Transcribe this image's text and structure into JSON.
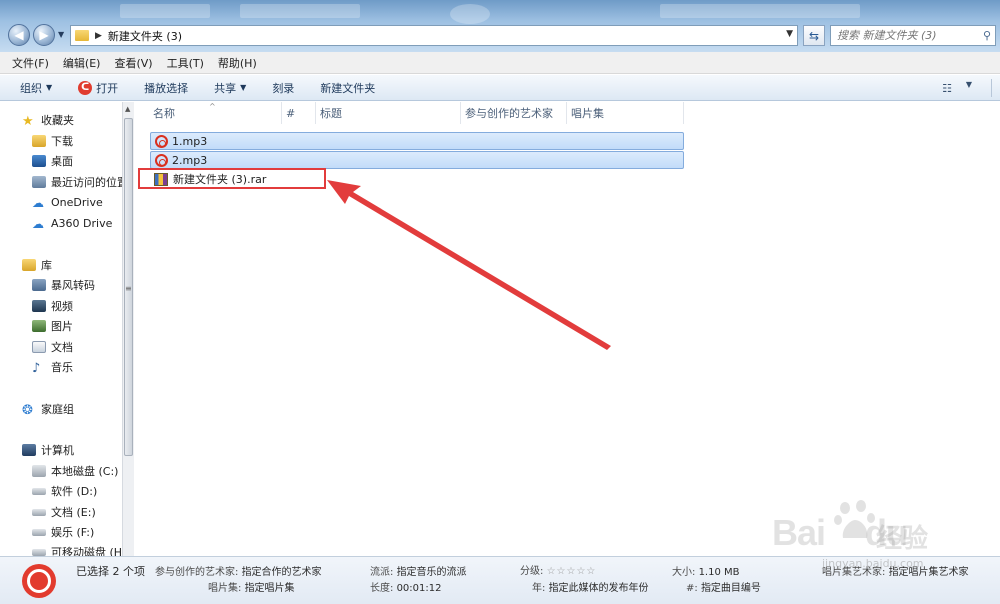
{
  "address": {
    "path": "新建文件夹 (3)"
  },
  "search": {
    "placeholder": "搜索 新建文件夹 (3)"
  },
  "menu": [
    "文件(F)",
    "编辑(E)",
    "查看(V)",
    "工具(T)",
    "帮助(H)"
  ],
  "toolbar": {
    "organize": "组织",
    "open": "打开",
    "play_all": "播放选择",
    "share": "共享",
    "burn": "刻录",
    "new_folder": "新建文件夹"
  },
  "sidebar": {
    "favorites": "收藏夹",
    "fav_items": [
      "下载",
      "桌面",
      "最近访问的位置",
      "OneDrive",
      "A360 Drive"
    ],
    "library": "库",
    "lib_items": [
      "暴风转码",
      "视频",
      "图片",
      "文档",
      "音乐"
    ],
    "homegroup": "家庭组",
    "computer": "计算机",
    "drives": [
      "本地磁盘 (C:)",
      "软件 (D:)",
      "文档 (E:)",
      "娱乐 (F:)",
      "可移动磁盘 (H"
    ]
  },
  "columns": [
    "名称",
    "#",
    "标题",
    "参与创作的艺术家",
    "唱片集"
  ],
  "files": [
    {
      "name": "1.mp3",
      "selected": true,
      "icon": "netease-music-icon"
    },
    {
      "name": "2.mp3",
      "selected": true,
      "icon": "netease-music-icon"
    },
    {
      "name": "新建文件夹 (3).rar",
      "selected": false,
      "icon": "winrar-icon"
    }
  ],
  "details": {
    "selected_count": "已选择 2 个项",
    "artist_k": "参与创作的艺术家:",
    "artist_v": "指定合作的艺术家",
    "album_k": "唱片集:",
    "album_v": "指定唱片集",
    "genre_k": "流派:",
    "genre_v": "指定音乐的流派",
    "length_k": "长度:",
    "length_v": "00:01:12",
    "rating_k": "分级:",
    "rating_stars": "☆☆☆☆☆",
    "year_k": "年:",
    "year_v": "指定此媒体的发布年份",
    "size_k": "大小:",
    "size_v": "1.10 MB",
    "track_k": "#:",
    "track_v": "指定曲目编号",
    "album_artist_k": "唱片集艺术家:",
    "album_artist_v": "指定唱片集艺术家"
  },
  "watermark": {
    "brand": "Bai",
    "brand2": "du",
    "cn": "经验",
    "url": "jingyan.baidu.com"
  },
  "colors": {
    "accent_red": "#e23c3c",
    "selection": "#c2dcf9"
  }
}
